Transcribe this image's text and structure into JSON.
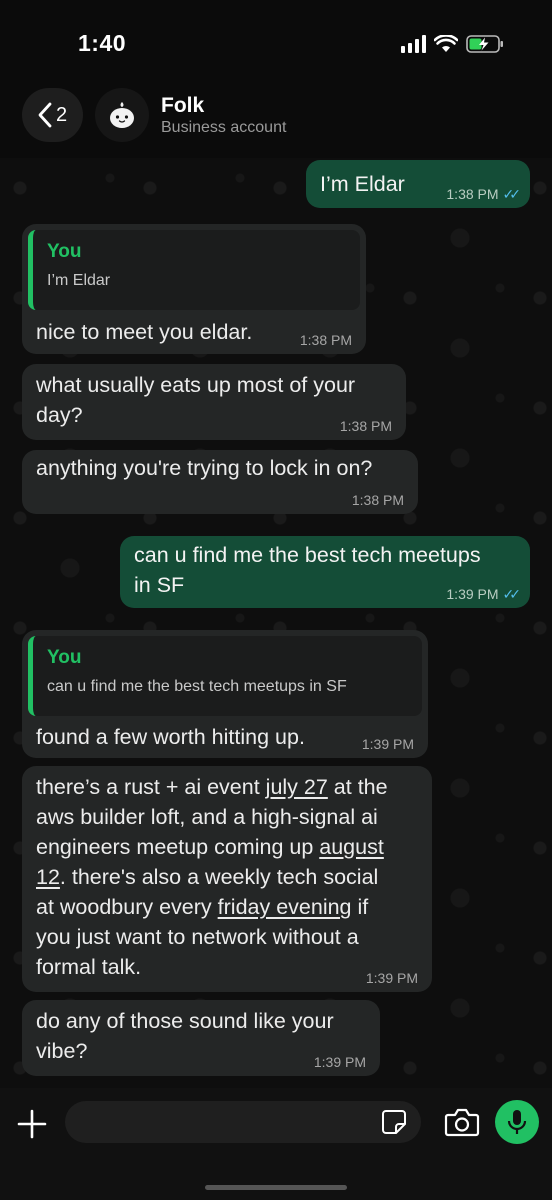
{
  "status_bar": {
    "time": "1:40"
  },
  "header": {
    "back_count": "2",
    "contact_name": "Folk",
    "contact_subtitle": "Business account"
  },
  "messages": [
    {
      "dir": "out",
      "text": "I’m Eldar",
      "time": "1:38 PM",
      "read": true
    },
    {
      "dir": "in",
      "quote_author": "You",
      "quote_text": "I’m Eldar",
      "text": "nice to meet you eldar.",
      "time": "1:38 PM"
    },
    {
      "dir": "in",
      "line1": "what usually eats up most of your",
      "line2": "day?",
      "time": "1:38 PM"
    },
    {
      "dir": "in",
      "text": "anything you're trying to lock in on?",
      "time": "1:38 PM"
    },
    {
      "dir": "out",
      "line1": "can u find me the best tech meetups",
      "line2": "in SF",
      "time": "1:39 PM",
      "read": true
    },
    {
      "dir": "in",
      "quote_author": "You",
      "quote_text": "can u find me the best tech meetups in SF",
      "text": "found a few worth hitting up.",
      "time": "1:39 PM"
    },
    {
      "dir": "in",
      "segments": [
        "there’s a rust + ai event ",
        "july 27",
        " at the",
        "aws builder loft, and a high-signal ai",
        "engineers meetup coming up ",
        "august",
        "12",
        ". there's also a weekly tech social",
        "at woodbury every ",
        "friday evening",
        " if",
        "you just want to network without a",
        "formal talk."
      ],
      "time": "1:39 PM"
    },
    {
      "dir": "in",
      "line1": "do any of those sound like your",
      "line2": "vibe?",
      "time": "1:39 PM"
    }
  ],
  "input": {
    "placeholder": ""
  },
  "colors": {
    "accent": "#21c063",
    "outgoing_bubble": "#144d37",
    "incoming_bubble": "#242626",
    "read_ticks": "#53bdeb"
  },
  "icons": [
    "back-chevron-icon",
    "signal-icon",
    "wifi-icon",
    "battery-charging-icon",
    "plus-icon",
    "sticker-icon",
    "camera-icon",
    "microphone-icon"
  ]
}
